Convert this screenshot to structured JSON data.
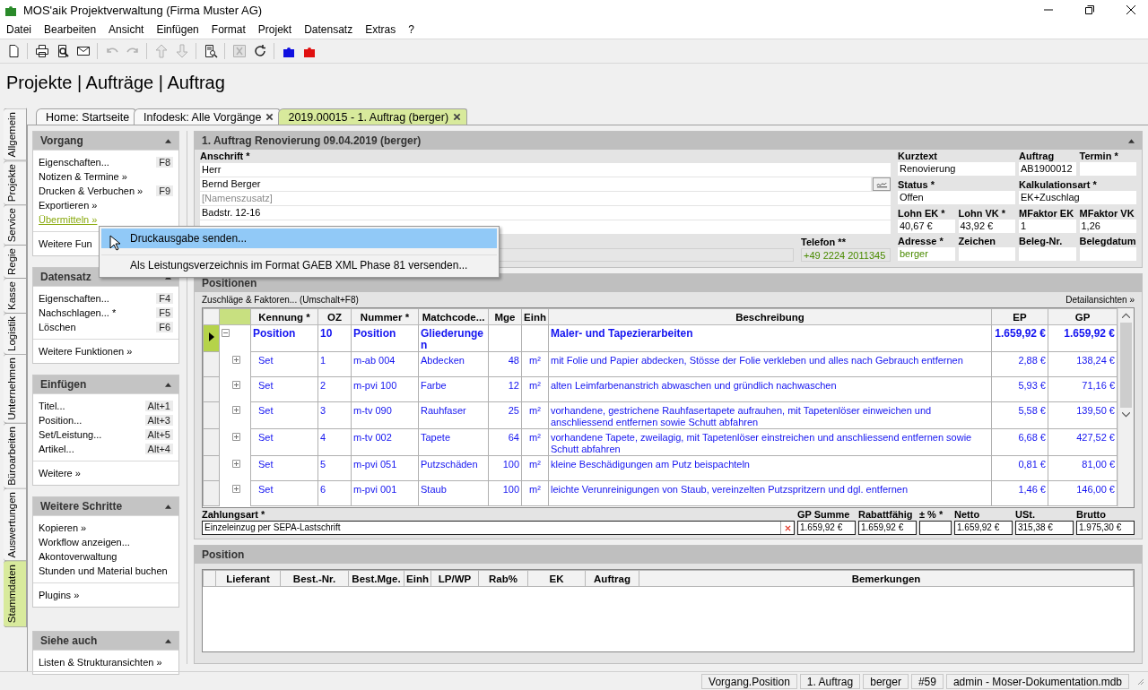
{
  "window": {
    "title": "MOS'aik Projektverwaltung (Firma Muster AG)"
  },
  "menu": [
    {
      "label": "Datei"
    },
    {
      "label": "Bearbeiten"
    },
    {
      "label": "Ansicht"
    },
    {
      "label": "Einfügen"
    },
    {
      "label": "Format"
    },
    {
      "label": "Projekt"
    },
    {
      "label": "Datensatz"
    },
    {
      "label": "Extras"
    },
    {
      "label": "?"
    }
  ],
  "toolbar": [
    [
      {
        "kind": "new",
        "disabled": false
      }
    ],
    [
      {
        "kind": "print",
        "disabled": false
      },
      {
        "kind": "preview",
        "disabled": false
      },
      {
        "kind": "mail",
        "disabled": false
      }
    ],
    [
      {
        "kind": "undo",
        "disabled": true
      },
      {
        "kind": "redo",
        "disabled": true
      }
    ],
    [
      {
        "kind": "up",
        "disabled": true
      },
      {
        "kind": "down",
        "disabled": true
      }
    ],
    [
      {
        "kind": "report",
        "disabled": false
      }
    ],
    [
      {
        "kind": "sheet",
        "disabled": true
      },
      {
        "kind": "refresh",
        "disabled": false
      }
    ],
    [
      {
        "kind": "puzzle",
        "color": "#1010e0",
        "disabled": false
      },
      {
        "kind": "puzzle",
        "color": "#e01010",
        "disabled": false
      }
    ]
  ],
  "breadcrumb": "Projekte | Aufträge | Auftrag",
  "side_tabs": [
    {
      "label": "Allgemein",
      "selected": false
    },
    {
      "label": "Projekte",
      "selected": false
    },
    {
      "label": "Service",
      "selected": false
    },
    {
      "label": "Regie",
      "selected": false
    },
    {
      "label": "Kasse",
      "selected": false
    },
    {
      "label": "Logistik",
      "selected": false
    },
    {
      "label": "Unternehmen",
      "selected": false
    },
    {
      "label": "Büroarbeiten",
      "selected": false
    },
    {
      "label": "Auswertungen",
      "selected": false
    },
    {
      "label": "Stammdaten",
      "selected": true
    }
  ],
  "doc_tabs": [
    {
      "label": "Home: Startseite",
      "selected": false,
      "closable": false
    },
    {
      "label": "Infodesk: Alle Vorgänge",
      "selected": false,
      "closable": true
    },
    {
      "label": "2019.00015 - 1. Auftrag (berger)",
      "selected": true,
      "closable": true
    }
  ],
  "sidebar": [
    {
      "title": "Vorgang",
      "expanded": true,
      "groups": [
        [
          {
            "label": "Eigenschaften...",
            "shortcut": "F8",
            "selected": false
          },
          {
            "label": "Notizen & Termine »",
            "selected": false
          },
          {
            "label": "Drucken & Verbuchen »",
            "shortcut": "F9",
            "selected": false
          },
          {
            "label": "Exportieren »",
            "selected": false
          },
          {
            "label": "Übermitteln »",
            "selected": true
          }
        ],
        [
          {
            "label": "Weitere Fun",
            "selected": false
          }
        ]
      ]
    },
    {
      "title": "Datensatz",
      "expanded": true,
      "groups": [
        [
          {
            "label": "Eigenschaften...",
            "shortcut": "F4",
            "selected": false
          },
          {
            "label": "Nachschlagen... *",
            "shortcut": "F5",
            "selected": false
          },
          {
            "label": "Löschen",
            "shortcut": "F6",
            "selected": false
          }
        ],
        [
          {
            "label": "Weitere Funktionen »",
            "selected": false
          }
        ]
      ]
    },
    {
      "title": "Einfügen",
      "expanded": true,
      "groups": [
        [
          {
            "label": "Titel...",
            "shortcut": "Alt+1",
            "selected": false
          },
          {
            "label": "Position...",
            "shortcut": "Alt+3",
            "selected": false
          },
          {
            "label": "Set/Leistung...",
            "shortcut": "Alt+5",
            "selected": false
          },
          {
            "label": "Artikel...",
            "shortcut": "Alt+4",
            "selected": false
          }
        ],
        [
          {
            "label": "Weitere »",
            "selected": false
          }
        ]
      ]
    },
    {
      "title": "Weitere Schritte",
      "expanded": true,
      "groups": [
        [
          {
            "label": "Kopieren »",
            "selected": false
          },
          {
            "label": "Workflow anzeigen...",
            "selected": false
          },
          {
            "label": "Akontoverwaltung",
            "selected": false
          },
          {
            "label": "Stunden und Material buchen",
            "selected": false
          }
        ],
        [
          {
            "label": "Plugins »",
            "selected": false
          }
        ]
      ]
    },
    {
      "title": "Siehe auch",
      "expanded": true,
      "groups": [
        [
          {
            "label": "Listen & Strukturansichten »",
            "selected": false
          }
        ]
      ]
    }
  ],
  "context_menu": [
    {
      "label": "Druckausgabe senden...",
      "selected": true
    },
    {
      "label": "Als Leistungsverzeichnis im Format GAEB XML Phase 81 versenden...",
      "selected": false
    }
  ],
  "order": {
    "title": "1. Auftrag Renovierung 09.04.2019 (berger)",
    "address_label": "Anschrift *",
    "address_lines": [
      {
        "value": "Herr"
      },
      {
        "value": "Bernd Berger",
        "button": true
      },
      {
        "placeholder": "[Namenszusatz]"
      },
      {
        "value": "Badstr. 12-16"
      }
    ],
    "phone": {
      "label": "Telefon **",
      "value": "+49 2224 2011345"
    },
    "fields": [
      [
        {
          "label": "Kurztext",
          "value": "Renovierung",
          "wide": true,
          "linked": false
        },
        {
          "label": "Auftrag",
          "value": "AB1900012",
          "wide": false,
          "linked": false
        },
        {
          "label": "Termin *",
          "wide": false
        }
      ],
      [
        {
          "label": "Status *",
          "value": "Offen",
          "wide": true,
          "linked": false
        },
        {
          "label": "Kalkulationsart *",
          "value": "EK+Zuschlag",
          "wide": true,
          "linked": false
        }
      ],
      [
        {
          "label": "Lohn EK *",
          "value": "40,67 €",
          "wide": false,
          "linked": false
        },
        {
          "label": "Lohn VK *",
          "value": "43,92 €",
          "wide": false,
          "linked": false
        },
        {
          "label": "MFaktor EK",
          "value": "1",
          "wide": false,
          "linked": false
        },
        {
          "label": "MFaktor VK",
          "value": "1,26",
          "wide": false,
          "linked": false
        }
      ],
      [
        {
          "label": "Adresse *",
          "value": "berger",
          "wide": false,
          "linked": true
        },
        {
          "label": "Zeichen",
          "wide": false
        },
        {
          "label": "Beleg-Nr.",
          "wide": false
        },
        {
          "label": "Belegdatum",
          "wide": false
        }
      ]
    ]
  },
  "positions": {
    "title": "Positionen",
    "toolbar_left": "Zuschläge & Faktoren... (Umschalt+F8)",
    "toolbar_right": "Detailansichten »",
    "columns": [
      "Kennung *",
      "OZ",
      "Nummer *",
      "Matchcode...",
      "Mge",
      "Einh",
      "Beschreibung",
      "EP",
      "GP"
    ],
    "rows": [
      {
        "kind": "title",
        "selected": true,
        "expanded": true,
        "cells": [
          "Position",
          "10",
          "Position",
          "Gliederungen",
          "",
          "",
          "Maler- und Tapezierarbeiten",
          "1.659,92 €",
          "1.659,92 €"
        ]
      },
      {
        "kind": "set",
        "selected": false,
        "expanded": false,
        "cells": [
          "Set",
          "1",
          "m-ab 004",
          "Abdecken",
          "48",
          "m²",
          "mit Folie und Papier abdecken, Stösse der Folie verkleben und alles nach Gebrauch entfernen",
          "2,88 €",
          "138,24 €"
        ]
      },
      {
        "kind": "set",
        "selected": false,
        "expanded": false,
        "cells": [
          "Set",
          "2",
          "m-pvi 100",
          "Farbe",
          "12",
          "m²",
          "alten Leimfarbenanstrich abwaschen und gründlich nachwaschen",
          "5,93 €",
          "71,16 €"
        ]
      },
      {
        "kind": "set",
        "selected": false,
        "expanded": false,
        "cells": [
          "Set",
          "3",
          "m-tv 090",
          "Rauhfaser",
          "25",
          "m²",
          "vorhandene, gestrichene Rauhfasertapete aufrauhen, mit Tapetenlöser einweichen und anschliessend entfernen sowie Schutt abfahren",
          "5,58 €",
          "139,50 €"
        ]
      },
      {
        "kind": "set",
        "selected": false,
        "expanded": false,
        "cells": [
          "Set",
          "4",
          "m-tv 002",
          "Tapete",
          "64",
          "m²",
          "vorhandene Tapete, zweilagig, mit Tapetenlöser einstreichen und anschliessend entfernen sowie Schutt abfahren",
          "6,68 €",
          "427,52 €"
        ]
      },
      {
        "kind": "set",
        "selected": false,
        "expanded": false,
        "cells": [
          "Set",
          "5",
          "m-pvi 051",
          "Putzschäden",
          "100",
          "m²",
          "kleine Beschädigungen am Putz beispachteln",
          "0,81 €",
          "81,00 €"
        ]
      },
      {
        "kind": "set",
        "selected": false,
        "expanded": false,
        "cells": [
          "Set",
          "6",
          "m-pvi 001",
          "Staub",
          "100",
          "m²",
          "leichte Verunreinigungen von Staub, vereinzelten Putzspritzern und dgl. entfernen",
          "1,46 €",
          "146,00 €"
        ]
      }
    ],
    "payment": {
      "label": "Zahlungsart *",
      "value": "Einzeleinzug per SEPA-Lastschrift"
    },
    "totals": [
      {
        "label": "GP Summe",
        "value": "1.659,92 €"
      },
      {
        "label": "Rabattfähig",
        "value": "1.659,92 €"
      },
      {
        "label": "± % *"
      },
      {
        "label": "Netto",
        "value": "1.659,92 €"
      },
      {
        "label": "USt.",
        "value": "315,38 €"
      },
      {
        "label": "Brutto",
        "value": "1.975,30 €"
      }
    ]
  },
  "position": {
    "title": "Position",
    "columns": [
      "Lieferant",
      "Best.-Nr.",
      "Best.Mge.",
      "Einh",
      "LP/WP",
      "Rab%",
      "EK",
      "Auftrag",
      "Bemerkungen"
    ]
  },
  "status_bar": [
    "Vorgang.Position",
    "1. Auftrag",
    "berger",
    "#59",
    "admin - Moser-Dokumentation.mdb"
  ]
}
